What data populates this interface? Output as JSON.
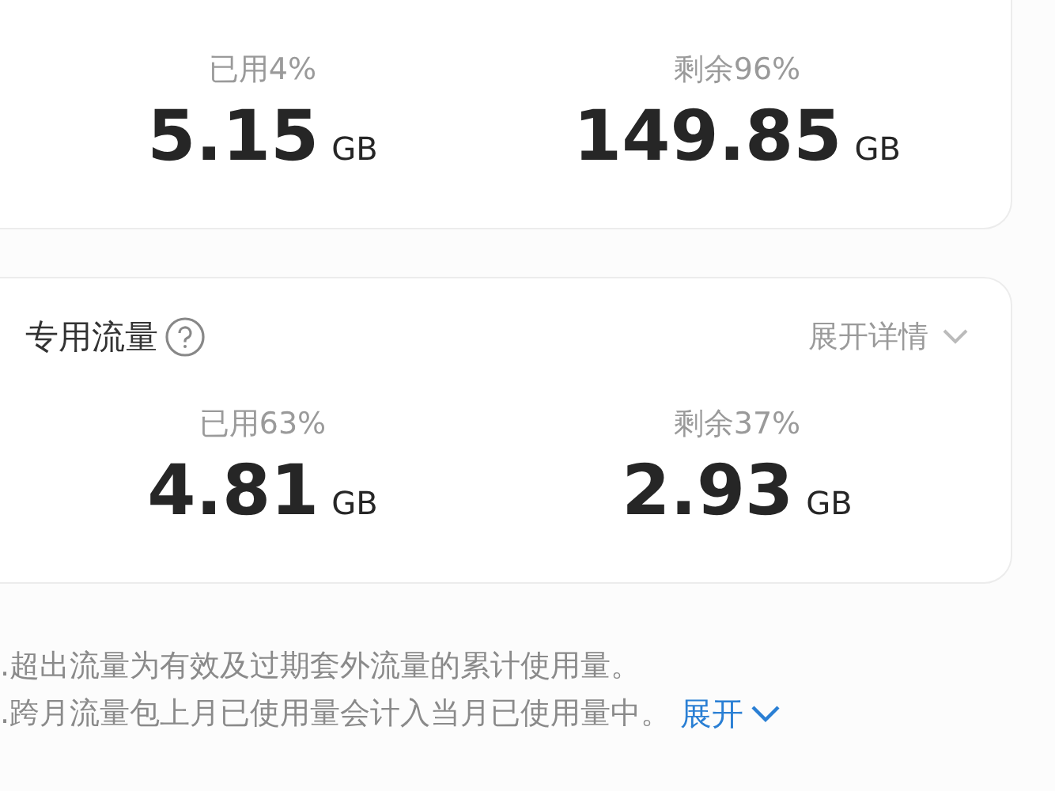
{
  "usage_card": {
    "stats": [
      {
        "label": "已用4%",
        "value": "5.15",
        "unit": "GB"
      },
      {
        "label": "剩余96%",
        "value": "149.85",
        "unit": "GB"
      }
    ]
  },
  "dedicated_card": {
    "title": "专用流量",
    "toggle": "展开详情",
    "stats": [
      {
        "label": "已用63%",
        "value": "4.81",
        "unit": "GB"
      },
      {
        "label": "剩余37%",
        "value": "2.93",
        "unit": "GB"
      }
    ]
  },
  "notes": {
    "lines": [
      ".超出流量为有效及过期套外流量的累计使用量。",
      ".跨月流量包上月已使用量会计入当月已使用量中。"
    ],
    "toggle": "展开"
  }
}
